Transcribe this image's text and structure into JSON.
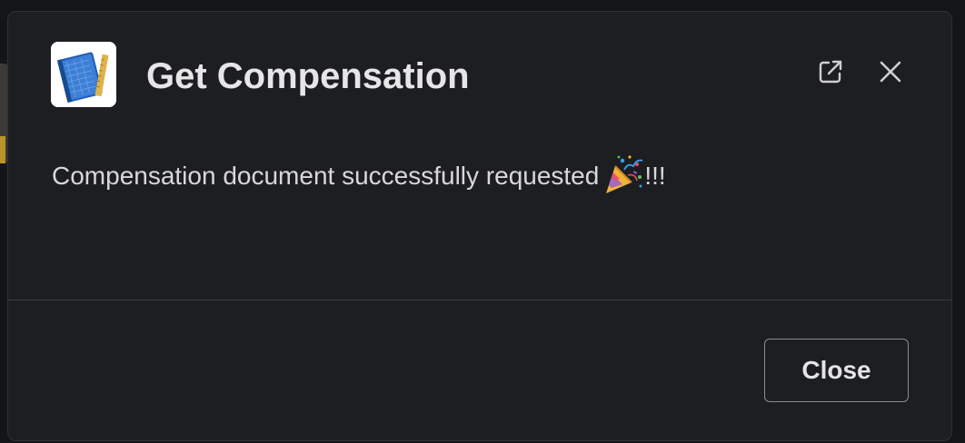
{
  "modal": {
    "title": "Get Compensation",
    "app_icon": "blueprint-book-icon",
    "header_actions": {
      "external_link_icon": "external-link-icon",
      "close_icon": "close-icon"
    },
    "message": {
      "text": "Compensation document successfully requested",
      "emoji": "party-popper-icon",
      "suffix": "!!!"
    },
    "footer": {
      "close_label": "Close"
    }
  },
  "colors": {
    "modal_background": "#1d1e22",
    "page_background": "#141518",
    "title_text": "#e6e6e7",
    "body_text": "#d8d8d9",
    "button_border": "#8b8c90"
  }
}
